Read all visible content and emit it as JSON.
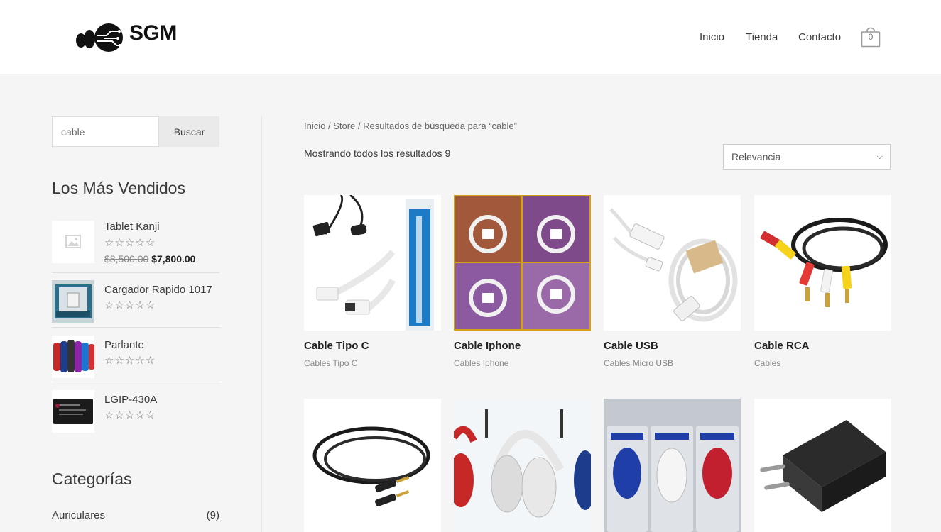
{
  "header": {
    "brand": "SGM",
    "nav": [
      "Inicio",
      "Tienda",
      "Contacto"
    ],
    "cart_count": "0"
  },
  "sidebar": {
    "search": {
      "value": "cable",
      "button": "Buscar"
    },
    "bestsellers_title": "Los Más Vendidos",
    "bestsellers": [
      {
        "name": "Tablet Kanji",
        "rating": "☆☆☆☆☆",
        "old_price": "$8,500.00",
        "price": "$7,800.00",
        "thumb_icon": "placeholder-image-icon"
      },
      {
        "name": "Cargador Rapido 1017",
        "rating": "☆☆☆☆☆",
        "thumb_icon": "charger-product-image"
      },
      {
        "name": "Parlante",
        "rating": "☆☆☆☆☆",
        "thumb_icon": "speaker-product-image"
      },
      {
        "name": "LGIP-430A",
        "rating": "☆☆☆☆☆",
        "thumb_icon": "battery-product-image"
      }
    ],
    "categories_title": "Categorías",
    "categories": [
      {
        "name": "Auriculares",
        "count": "(9)"
      }
    ]
  },
  "main": {
    "breadcrumb": [
      "Inicio",
      " / ",
      "Store",
      " / Resultados de búsqueda para “cable”"
    ],
    "result_count": "Mostrando todos los resultados 9",
    "sort": {
      "selected": "Relevancia"
    },
    "products": [
      {
        "title": "Cable Tipo C",
        "category": "Cables Tipo C"
      },
      {
        "title": "Cable Iphone",
        "category": "Cables Iphone"
      },
      {
        "title": "Cable USB",
        "category": "Cables Micro USB"
      },
      {
        "title": "Cable RCA",
        "category": "Cables"
      },
      {
        "title": "",
        "category": ""
      },
      {
        "title": "",
        "category": ""
      },
      {
        "title": "",
        "category": ""
      },
      {
        "title": "",
        "category": ""
      }
    ]
  },
  "colors": {
    "accent": "#3a3a3a",
    "background": "#f5f5f5",
    "header_bg": "#ffffff"
  }
}
